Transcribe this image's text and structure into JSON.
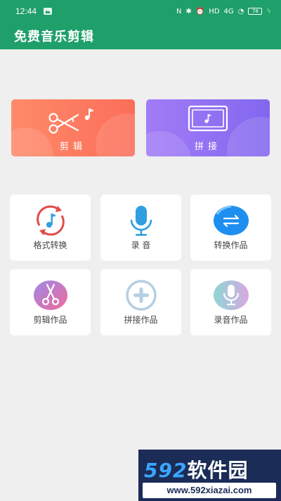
{
  "status_bar": {
    "time": "12:44",
    "network": "HD",
    "signal": "4G",
    "battery": "78"
  },
  "app_bar": {
    "title": "免费音乐剪辑"
  },
  "big_cards": [
    {
      "label": "剪辑",
      "icon": "scissors-music-icon",
      "color": "#fb7a5f"
    },
    {
      "label": "拼接",
      "icon": "screen-music-icon",
      "color": "#8f6ff1"
    }
  ],
  "grid": [
    {
      "label": "格式转换",
      "icon": "format-convert-icon"
    },
    {
      "label": "录 音",
      "icon": "microphone-icon"
    },
    {
      "label": "转换作品",
      "icon": "converted-works-icon"
    },
    {
      "label": "剪辑作品",
      "icon": "edited-works-icon"
    },
    {
      "label": "拼接作品",
      "icon": "joined-works-icon"
    },
    {
      "label": "录音作品",
      "icon": "recorded-works-icon"
    }
  ],
  "watermark": {
    "brand_num": "592",
    "brand_text": "软件园",
    "url": "www.592xiazai.com"
  },
  "colors": {
    "primary": "#1f9f6a",
    "background": "#efefef"
  }
}
